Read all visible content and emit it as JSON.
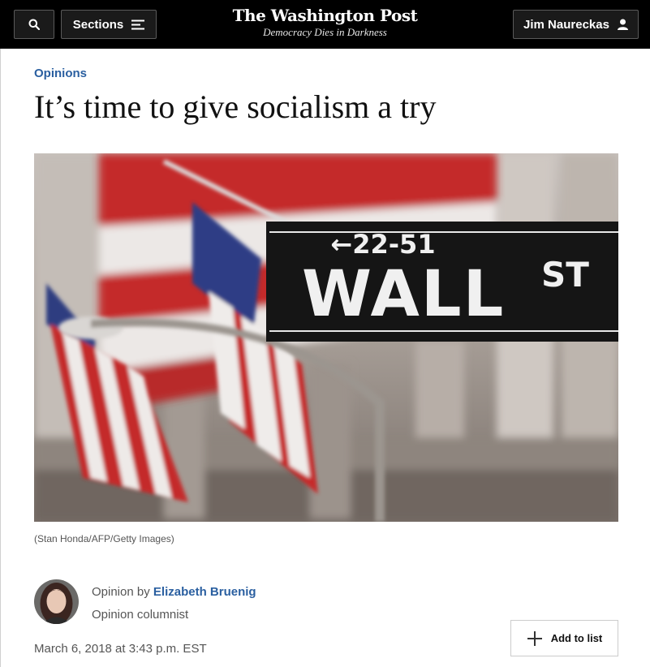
{
  "header": {
    "search_icon": "search-icon",
    "sections_label": "Sections",
    "sections_icon": "menu-lines-icon",
    "logo_text": "The Washington Post",
    "tagline": "Democracy Dies in Darkness",
    "user_label": "Jim Naureckas",
    "user_icon": "person-icon"
  },
  "article": {
    "kicker": "Opinions",
    "headline": "It’s time to give socialism a try",
    "image_caption": "(Stan Honda/AFP/Getty Images)",
    "sign_arrow_text": "←22-51",
    "sign_main_text": "WALL",
    "sign_suffix_text": "ST",
    "byline_prefix": "Opinion by ",
    "author": "Elizabeth Bruenig",
    "author_role": "Opinion columnist",
    "date": "March 6, 2018 at 3:43 p.m. EST",
    "add_to_list_label": "Add to list"
  },
  "colors": {
    "topbar": "#000000",
    "link_blue": "#2a5fa0",
    "meta_gray": "#555555"
  }
}
